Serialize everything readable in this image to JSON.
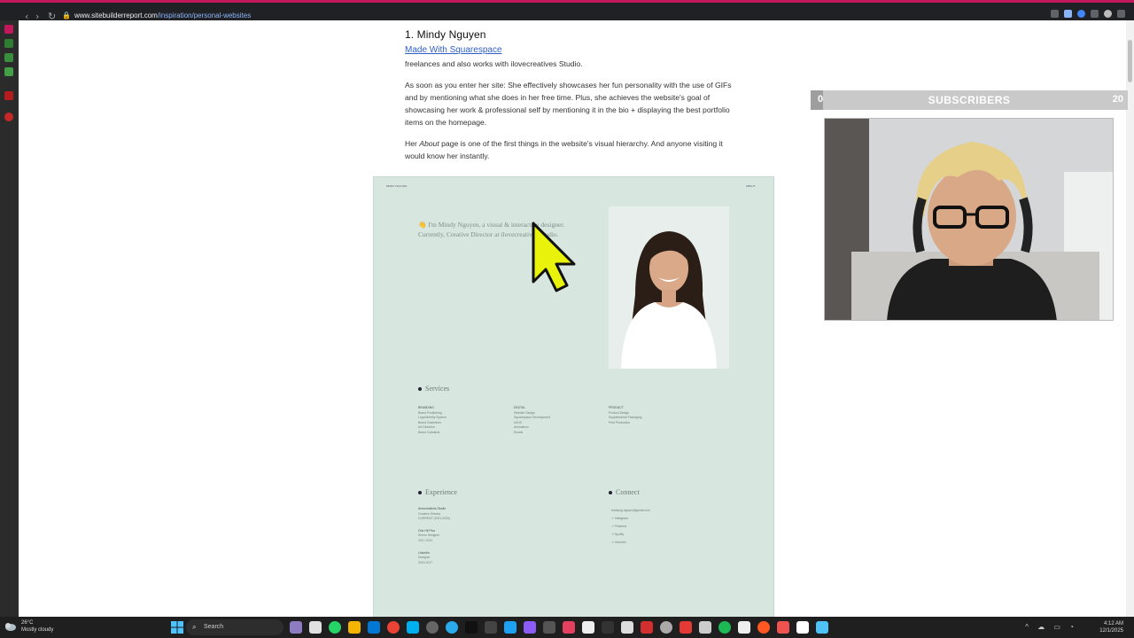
{
  "browser": {
    "url_host": "www.sitebuilderreport.com",
    "url_path": "/inspiration/personal-websites"
  },
  "article": {
    "heading": "1. Mindy Nguyen",
    "made_with": "Made With Squarespace",
    "clipped_line": "freelances and also works with ilovecreatives Studio.",
    "para2": "As soon as you enter her site: She effectively showcases her fun personality with the use of GIFs and by mentioning what she does in her free time. Plus, she achieves the website's goal of showcasing her work & professional self by mentioning it in the bio + displaying the best portfolio items on the homepage.",
    "para3_pre": "Her ",
    "para3_em": "About",
    "para3_post": " page is one of the first things in the website's visual hierarchy. And anyone visiting it would know her instantly."
  },
  "preview": {
    "nav_left": "MINDY NGUYEN",
    "nav_right": "ABOUT",
    "intro": "👋 I'm Mindy Nguyen, a visual & interactive designer. Currently, Creative Director at ilovecreatives Studio.",
    "services_title": "Services",
    "services_cols": [
      {
        "head": "BRANDING",
        "items": [
          "Brand Positioning",
          "Logo/Identity System",
          "Brand Guidelines",
          "Art Direction",
          "Brand Collateral"
        ]
      },
      {
        "head": "DIGITAL",
        "items": [
          "Website Design",
          "Squarespace Development",
          "UI/UX",
          "Animations",
          "Emails"
        ]
      },
      {
        "head": "PRODUCT",
        "items": [
          "Product Design",
          "Supplemental Packaging",
          "Print Production"
        ]
      }
    ],
    "experience_title": "Experience",
    "experience": [
      {
        "name": "ilovecreatives Studio",
        "role": "Creative Director",
        "years": "CURRENT (2021-2025)"
      },
      {
        "name": "One Hit Plus",
        "role": "Senior Designer",
        "years": "2017-2021"
      },
      {
        "name": "LinkedIn",
        "role": "Designer",
        "years": "2015-2017"
      }
    ],
    "connect_title": "Connect",
    "connect": [
      "mindyng.nguyen@gmail.com",
      "↗ Instagram",
      "↗ Pinterest",
      "↗ Spotify",
      "↗ LinkedIn"
    ]
  },
  "overlay": {
    "subs_min": "0",
    "subs_label": "SUBSCRIBERS",
    "subs_max": "20",
    "subs_progress": 0.04
  },
  "taskbar": {
    "temp": "26°C",
    "condition": "Mostly cloudy",
    "search": "Search",
    "time": "4:12 AM",
    "date": "12/1/2025"
  }
}
